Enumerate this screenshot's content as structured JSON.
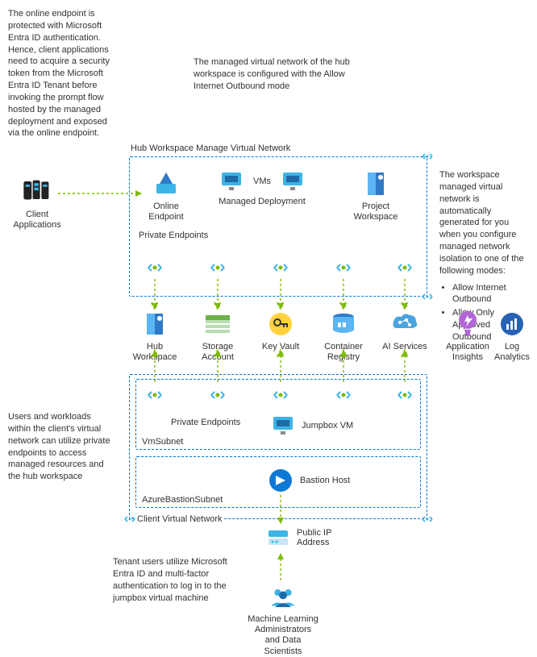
{
  "notes": {
    "topleft": "The online endpoint is protected with Microsoft Entra ID authentication. Hence, client applications need to acquire a security token from the Microsoft Entra ID Tenant before invoking the prompt flow hosted by the managed deployment and exposed via the online endpoint.",
    "topcenter": "The managed virtual network of the hub workspace is configured with the Allow Internet Outbound mode",
    "right_top": "The workspace managed virtual network is automatically generated for you when you configure managed network isolation to one of the following modes:",
    "right_bullet1": "Allow Internet Outbound",
    "right_bullet2": "Allow Only Approved Outbound",
    "left_mid": "Users and workloads within the client's virtual network can utilize private endpoints to access managed resources and the hub workspace",
    "bottom_center": "Tenant users utilize Microsoft Entra ID and multi-factor authentication to log in to the jumpbox virtual machine"
  },
  "labels": {
    "hub_vnet_box": "Hub Workspace Manage Virtual Network",
    "private_endpoints_section": "Private Endpoints",
    "client_vnet_box": "Client Virtual Network",
    "vmsubnet": "VmSubnet",
    "bastion_subnet": "AzureBastionSubnet",
    "private_endpoints_2": "Private Endpoints"
  },
  "services": {
    "client_apps": "Client Applications",
    "online_endpoint": "Online Endpoint",
    "managed_deployment_vms": "VMs",
    "managed_deployment": "Managed Deployment",
    "project_workspace": "Project Workspace",
    "hub_workspace": "Hub Workspace",
    "storage_account": "Storage Account",
    "key_vault": "Key Vault",
    "container_registry": "Container Registry",
    "ai_services": "AI Services",
    "application_insights": "Application Insights",
    "log_analytics": "Log Analytics",
    "jumpbox_vm": "Jumpbox VM",
    "bastion_host": "Bastion Host",
    "public_ip": "Public IP Address",
    "ml_admins": "Machine Learning Administrators and Data Scientists"
  },
  "connections": {
    "client_apps_to_online_endpoint": {
      "from": "client_apps",
      "to": "online_endpoint",
      "style": "dotted-green"
    },
    "private_endpoints_row1_to_row2": [
      {
        "from": "pe_hub_top",
        "to": "hub_workspace"
      },
      {
        "from": "pe_storage_top",
        "to": "storage_account"
      },
      {
        "from": "pe_kv_top",
        "to": "key_vault"
      },
      {
        "from": "pe_cr_top",
        "to": "container_registry"
      },
      {
        "from": "pe_ai_top",
        "to": "ai_services"
      }
    ],
    "row2_to_client_pe": [
      {
        "from": "hub_workspace",
        "to": "pe_hub_bottom"
      },
      {
        "from": "storage_account",
        "to": "pe_storage_bottom"
      },
      {
        "from": "key_vault",
        "to": "pe_kv_bottom"
      },
      {
        "from": "container_registry",
        "to": "pe_cr_bottom"
      },
      {
        "from": "ai_services",
        "to": "pe_ai_bottom"
      }
    ],
    "bastion_to_public_ip": {
      "from": "bastion_host",
      "to": "public_ip"
    },
    "public_ip_to_users": {
      "from": "ml_admins",
      "to": "public_ip"
    }
  }
}
